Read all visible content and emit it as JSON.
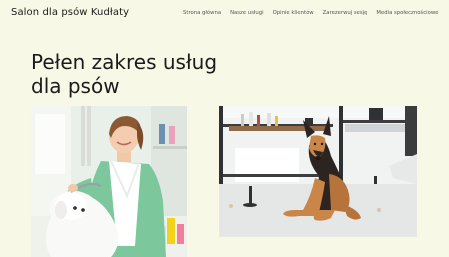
{
  "header": {
    "brand": "Salon dla psów Kudłaty",
    "nav": [
      {
        "label": "Strona główna"
      },
      {
        "label": "Nasze usługi"
      },
      {
        "label": "Opinie klientów"
      },
      {
        "label": "Zarezerwuj sesję"
      },
      {
        "label": "Media społecznościowe"
      }
    ]
  },
  "hero": {
    "title": "Pełen zakres usług dla psów"
  },
  "images": {
    "groomer": "groomer-photo",
    "dog": "german-shepherd-photo"
  },
  "colors": {
    "background": "#f7f8e6",
    "text": "#1b1b1b",
    "nav_text": "#555555"
  }
}
